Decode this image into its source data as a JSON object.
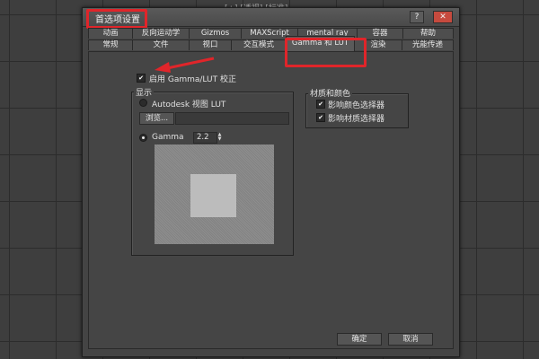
{
  "viewport": {
    "label": "[+] [透视] [标准]"
  },
  "dialog": {
    "title": "首选项设置",
    "help_label": "?",
    "close_label": "✕"
  },
  "tabs_row1": [
    "动画",
    "反向运动学",
    "Gizmos",
    "MAXScript",
    "mental ray",
    "容器",
    "帮助"
  ],
  "tabs_row2": [
    "常规",
    "文件",
    "视口",
    "交互模式",
    "Gamma 和 LUT",
    "渲染",
    "光能传递"
  ],
  "active_tab": "Gamma 和 LUT",
  "enable": {
    "label": "启用 Gamma/LUT 校正",
    "checked": true
  },
  "display_group": {
    "title": "显示",
    "lut_option": "Autodesk 视图 LUT",
    "browse_label": "浏览...",
    "lut_path": "",
    "gamma_option": "Gamma",
    "gamma_value": "2.2"
  },
  "materials_group": {
    "title": "材质和颜色",
    "color_picker": {
      "label": "影响颜色选择器",
      "checked": true
    },
    "material_picker": {
      "label": "影响材质选择器",
      "checked": true
    }
  },
  "footer": {
    "ok_label": "确定",
    "cancel_label": "取消"
  },
  "colors": {
    "highlight": "#e0252a",
    "dialog_bg": "#444444"
  }
}
